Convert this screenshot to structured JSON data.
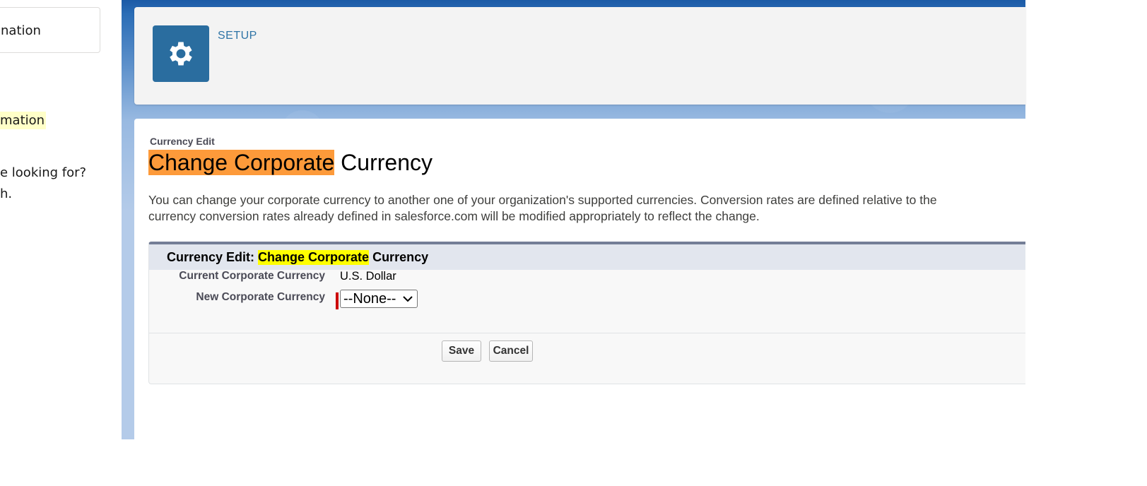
{
  "sidebar": {
    "card_text": "nation",
    "highlight_text": "mation",
    "help_line1": "e looking for?",
    "help_line2": "h."
  },
  "header": {
    "icon": "gear-icon",
    "label": "SETUP"
  },
  "page": {
    "breadcrumb": "Currency Edit",
    "title_highlight": "Change Corporate",
    "title_rest": " Currency",
    "description_line1": "You can change your corporate currency to another one of your organization's supported currencies. Conversion rates are defined relative to the",
    "description_line2": "currency conversion rates already defined in salesforce.com will be modified appropriately to reflect the change."
  },
  "block": {
    "head_prefix": "Currency Edit: ",
    "head_highlight": "Change Corporate",
    "head_suffix": " Currency",
    "current_label": "Current Corporate Currency",
    "current_value": "U.S. Dollar",
    "new_label": "New Corporate Currency",
    "new_value": "--None--",
    "save_label": "Save",
    "cancel_label": "Cancel"
  },
  "colors": {
    "title_highlight": "#fd9a3a",
    "head_highlight": "#ffff00",
    "setup_icon_bg": "#2a6d9f",
    "required": "#cc0000"
  }
}
